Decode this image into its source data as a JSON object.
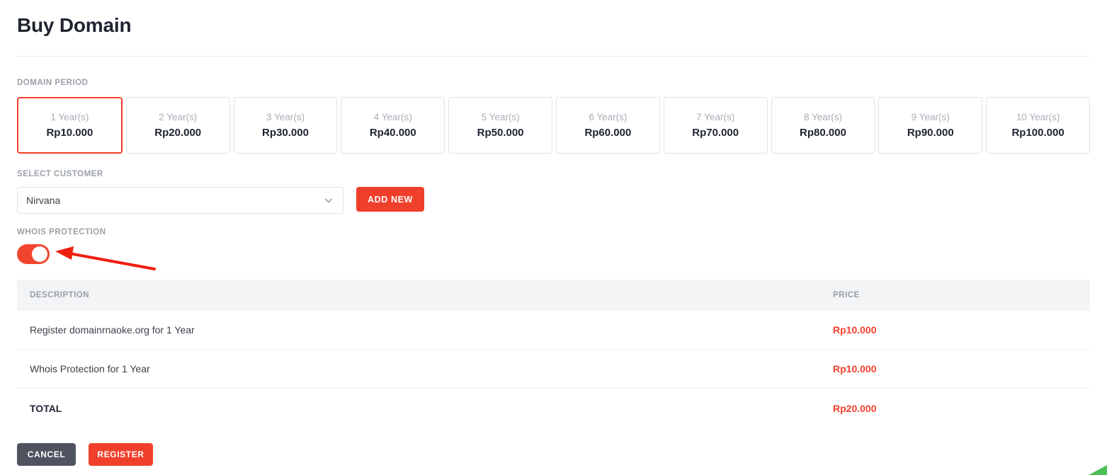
{
  "header": {
    "title": "Buy Domain"
  },
  "domain_period": {
    "label": "DOMAIN PERIOD",
    "selected_index": 0,
    "options": [
      {
        "years": "1 Year(s)",
        "price": "Rp10.000"
      },
      {
        "years": "2 Year(s)",
        "price": "Rp20.000"
      },
      {
        "years": "3 Year(s)",
        "price": "Rp30.000"
      },
      {
        "years": "4 Year(s)",
        "price": "Rp40.000"
      },
      {
        "years": "5 Year(s)",
        "price": "Rp50.000"
      },
      {
        "years": "6 Year(s)",
        "price": "Rp60.000"
      },
      {
        "years": "7 Year(s)",
        "price": "Rp70.000"
      },
      {
        "years": "8 Year(s)",
        "price": "Rp80.000"
      },
      {
        "years": "9 Year(s)",
        "price": "Rp90.000"
      },
      {
        "years": "10 Year(s)",
        "price": "Rp100.000"
      }
    ]
  },
  "select_customer": {
    "label": "SELECT CUSTOMER",
    "value": "Nirvana",
    "add_new_label": "ADD NEW",
    "chevron_icon": "chevron-down-icon"
  },
  "whois_protection": {
    "label": "WHOIS PROTECTION",
    "enabled": true,
    "state_text": "on"
  },
  "summary": {
    "columns": [
      "DESCRIPTION",
      "PRICE"
    ],
    "rows": [
      {
        "description": "Register domainrnaoke.org for 1 Year",
        "price": "Rp10.000"
      },
      {
        "description": "Whois Protection for 1 Year",
        "price": "Rp10.000"
      }
    ],
    "total_label": "TOTAL",
    "total_price": "Rp20.000"
  },
  "footer": {
    "cancel_label": "CANCEL",
    "register_label": "REGISTER"
  },
  "annotation": {
    "arrow_icon": "red-arrow-pointing-left",
    "arrow_color": "#f01f0f",
    "target": "whois-protection-toggle"
  },
  "colors": {
    "accent_red": "#f0402c",
    "toggle_on": "#f2452f",
    "cancel_gray": "#4f5360",
    "table_head_bg": "#f2f4f6",
    "muted_text": "#9aa0a8",
    "green_corner": "#4cbf56"
  }
}
